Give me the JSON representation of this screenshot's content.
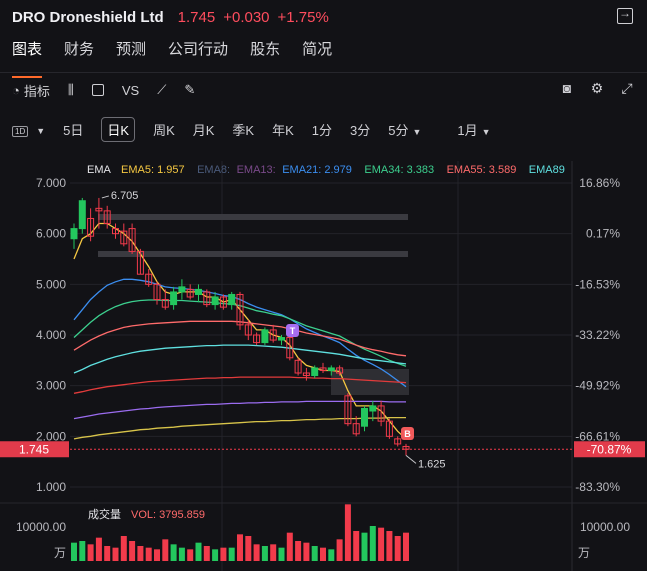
{
  "header": {
    "name": "DRO Droneshield Ltd",
    "price": "1.745",
    "change": "+0.030",
    "change_pct": "+1.75%"
  },
  "tabs": [
    "图表",
    "财务",
    "预测",
    "公司行动",
    "股东",
    "简况"
  ],
  "toolbar": {
    "indicator": "指标",
    "vs": "VS"
  },
  "periods": {
    "badge": "1D",
    "items": [
      "5日",
      "日K",
      "周K",
      "月K",
      "季K",
      "年K",
      "1分",
      "3分",
      "5分",
      "1月"
    ]
  },
  "legend": {
    "label": "EMA",
    "items": [
      {
        "text": "EMA5: 1.957",
        "color": "#f5c842"
      },
      {
        "text": "EMA8:",
        "color": "#4a5a7a"
      },
      {
        "text": "EMA13:",
        "color": "#7a4a8a"
      },
      {
        "text": "EMA21: 2.979",
        "color": "#3b8ef0"
      },
      {
        "text": "EMA34: 3.383",
        "color": "#3ccf8e"
      },
      {
        "text": "EMA55: 3.589",
        "color": "#ff6b6b"
      },
      {
        "text": "EMA89",
        "color": "#5fe0e0"
      }
    ]
  },
  "annotations": {
    "high": "6.705",
    "low": "1.625",
    "marker_t": "T",
    "marker_b": "B"
  },
  "price_tag": {
    "left": "1.745",
    "right": "-70.87%"
  },
  "volume": {
    "title": "成交量",
    "vol": "VOL: 3795.859",
    "left_axis": "10000.00",
    "left_unit": "万",
    "right_axis": "10000.00",
    "right_unit": "万"
  },
  "chart_data": {
    "type": "candlestick",
    "y_axis_left": [
      "7.000",
      "6.000",
      "5.000",
      "4.000",
      "3.000",
      "2.000",
      "1.000"
    ],
    "y_axis_right": [
      "16.86%",
      "0.17%",
      "-16.53%",
      "-33.22%",
      "-49.92%",
      "-66.61%",
      "-83.30%"
    ],
    "ylim": [
      1.0,
      7.0
    ],
    "candles": [
      {
        "o": 5.9,
        "h": 6.2,
        "l": 5.7,
        "c": 6.1
      },
      {
        "o": 6.1,
        "h": 6.705,
        "l": 6.0,
        "c": 6.65
      },
      {
        "o": 6.3,
        "h": 6.5,
        "l": 5.85,
        "c": 5.95
      },
      {
        "o": 6.5,
        "h": 6.705,
        "l": 6.1,
        "c": 6.45
      },
      {
        "o": 6.45,
        "h": 6.55,
        "l": 6.1,
        "c": 6.2
      },
      {
        "o": 6.1,
        "h": 6.2,
        "l": 5.9,
        "c": 6.0
      },
      {
        "o": 6.05,
        "h": 6.2,
        "l": 5.75,
        "c": 5.8
      },
      {
        "o": 6.1,
        "h": 6.2,
        "l": 5.6,
        "c": 5.65
      },
      {
        "o": 5.65,
        "h": 5.7,
        "l": 5.2,
        "c": 5.2
      },
      {
        "o": 5.2,
        "h": 5.3,
        "l": 4.95,
        "c": 5.0
      },
      {
        "o": 5.0,
        "h": 5.05,
        "l": 4.6,
        "c": 4.7
      },
      {
        "o": 4.7,
        "h": 4.9,
        "l": 4.5,
        "c": 4.55
      },
      {
        "o": 4.6,
        "h": 4.95,
        "l": 4.5,
        "c": 4.85
      },
      {
        "o": 4.85,
        "h": 5.1,
        "l": 4.7,
        "c": 4.95
      },
      {
        "o": 4.9,
        "h": 5.0,
        "l": 4.7,
        "c": 4.75
      },
      {
        "o": 4.8,
        "h": 5.0,
        "l": 4.65,
        "c": 4.9
      },
      {
        "o": 4.85,
        "h": 4.9,
        "l": 4.55,
        "c": 4.6
      },
      {
        "o": 4.6,
        "h": 4.85,
        "l": 4.5,
        "c": 4.75
      },
      {
        "o": 4.75,
        "h": 4.8,
        "l": 4.5,
        "c": 4.55
      },
      {
        "o": 4.6,
        "h": 4.85,
        "l": 4.5,
        "c": 4.8
      },
      {
        "o": 4.8,
        "h": 4.85,
        "l": 4.1,
        "c": 4.2
      },
      {
        "o": 4.2,
        "h": 4.3,
        "l": 3.9,
        "c": 4.0
      },
      {
        "o": 4.0,
        "h": 4.05,
        "l": 3.8,
        "c": 3.85
      },
      {
        "o": 3.85,
        "h": 4.15,
        "l": 3.8,
        "c": 4.1
      },
      {
        "o": 4.1,
        "h": 4.2,
        "l": 3.85,
        "c": 3.9
      },
      {
        "o": 3.9,
        "h": 4.0,
        "l": 3.8,
        "c": 3.95
      },
      {
        "o": 3.95,
        "h": 4.05,
        "l": 3.5,
        "c": 3.55
      },
      {
        "o": 3.5,
        "h": 3.55,
        "l": 3.2,
        "c": 3.25
      },
      {
        "o": 3.25,
        "h": 3.35,
        "l": 3.1,
        "c": 3.2
      },
      {
        "o": 3.2,
        "h": 3.4,
        "l": 3.15,
        "c": 3.35
      },
      {
        "o": 3.35,
        "h": 3.45,
        "l": 3.25,
        "c": 3.3
      },
      {
        "o": 3.3,
        "h": 3.4,
        "l": 3.2,
        "c": 3.35
      },
      {
        "o": 3.35,
        "h": 3.4,
        "l": 3.2,
        "c": 3.25
      },
      {
        "o": 2.8,
        "h": 2.85,
        "l": 2.2,
        "c": 2.25
      },
      {
        "o": 2.25,
        "h": 2.4,
        "l": 2.0,
        "c": 2.05
      },
      {
        "o": 2.2,
        "h": 2.6,
        "l": 2.1,
        "c": 2.55
      },
      {
        "o": 2.5,
        "h": 2.7,
        "l": 2.3,
        "c": 2.6
      },
      {
        "o": 2.6,
        "h": 2.7,
        "l": 2.2,
        "c": 2.3
      },
      {
        "o": 2.3,
        "h": 2.35,
        "l": 1.95,
        "c": 2.0
      },
      {
        "o": 1.95,
        "h": 2.0,
        "l": 1.8,
        "c": 1.85
      },
      {
        "o": 1.8,
        "h": 1.85,
        "l": 1.625,
        "c": 1.745
      }
    ],
    "ema": [
      {
        "name": "EMA5",
        "color": "#f5c842",
        "values": [
          5.5,
          5.9,
          6.0,
          6.2,
          6.2,
          6.1,
          6.0,
          5.85,
          5.6,
          5.35,
          5.05,
          4.85,
          4.8,
          4.85,
          4.85,
          4.85,
          4.75,
          4.75,
          4.65,
          4.7,
          4.5,
          4.3,
          4.1,
          4.1,
          4.0,
          3.95,
          3.8,
          3.55,
          3.4,
          3.35,
          3.3,
          3.3,
          3.28,
          2.9,
          2.6,
          2.6,
          2.6,
          2.5,
          2.3,
          2.1,
          1.95
        ]
      },
      {
        "name": "EMA21",
        "color": "#3b8ef0",
        "values": [
          4.3,
          4.5,
          4.7,
          4.85,
          4.98,
          5.05,
          5.1,
          5.1,
          5.08,
          5.05,
          5.0,
          4.95,
          4.93,
          4.92,
          4.9,
          4.88,
          4.85,
          4.82,
          4.78,
          4.76,
          4.7,
          4.62,
          4.55,
          4.5,
          4.45,
          4.4,
          4.32,
          4.22,
          4.12,
          4.05,
          3.98,
          3.92,
          3.85,
          3.72,
          3.6,
          3.5,
          3.42,
          3.33,
          3.22,
          3.1,
          2.979
        ]
      },
      {
        "name": "EMA34",
        "color": "#3ccf8e",
        "values": [
          3.95,
          4.1,
          4.25,
          4.38,
          4.48,
          4.56,
          4.62,
          4.66,
          4.68,
          4.69,
          4.69,
          4.68,
          4.68,
          4.68,
          4.67,
          4.66,
          4.65,
          4.64,
          4.62,
          4.61,
          4.58,
          4.53,
          4.48,
          4.45,
          4.41,
          4.38,
          4.32,
          4.25,
          4.18,
          4.13,
          4.08,
          4.03,
          3.98,
          3.89,
          3.8,
          3.72,
          3.65,
          3.58,
          3.5,
          3.44,
          3.383
        ]
      },
      {
        "name": "EMA55",
        "color": "#ff6b6b",
        "values": [
          3.7,
          3.8,
          3.9,
          3.98,
          4.05,
          4.1,
          4.15,
          4.18,
          4.2,
          4.22,
          4.23,
          4.24,
          4.25,
          4.26,
          4.27,
          4.27,
          4.27,
          4.27,
          4.27,
          4.27,
          4.26,
          4.24,
          4.22,
          4.2,
          4.18,
          4.16,
          4.12,
          4.08,
          4.04,
          4.01,
          3.98,
          3.95,
          3.92,
          3.86,
          3.8,
          3.75,
          3.71,
          3.68,
          3.64,
          3.61,
          3.589
        ]
      },
      {
        "name": "EMA89",
        "color": "#5fe0e0",
        "values": [
          3.25,
          3.32,
          3.4,
          3.46,
          3.52,
          3.57,
          3.61,
          3.65,
          3.68,
          3.7,
          3.72,
          3.74,
          3.75,
          3.76,
          3.77,
          3.78,
          3.79,
          3.79,
          3.8,
          3.8,
          3.8,
          3.8,
          3.79,
          3.78,
          3.77,
          3.76,
          3.74,
          3.72,
          3.7,
          3.68,
          3.66,
          3.64,
          3.62,
          3.59,
          3.56,
          3.53,
          3.51,
          3.49,
          3.47,
          3.45,
          3.43
        ]
      },
      {
        "name": "EMA144",
        "color": "#e23b3b",
        "values": [
          2.85,
          2.88,
          2.92,
          2.95,
          2.98,
          3.0,
          3.02,
          3.04,
          3.06,
          3.08,
          3.09,
          3.1,
          3.11,
          3.12,
          3.13,
          3.14,
          3.15,
          3.15,
          3.16,
          3.16,
          3.17,
          3.17,
          3.17,
          3.17,
          3.17,
          3.17,
          3.17,
          3.16,
          3.16,
          3.15,
          3.15,
          3.14,
          3.14,
          3.13,
          3.12,
          3.11,
          3.1,
          3.09,
          3.08,
          3.07,
          3.06
        ]
      },
      {
        "name": "EMA233",
        "color": "#9b6cf0",
        "values": [
          2.35,
          2.38,
          2.41,
          2.44,
          2.46,
          2.48,
          2.5,
          2.52,
          2.54,
          2.55,
          2.57,
          2.58,
          2.59,
          2.6,
          2.61,
          2.62,
          2.63,
          2.63,
          2.64,
          2.65,
          2.65,
          2.66,
          2.66,
          2.67,
          2.67,
          2.68,
          2.68,
          2.68,
          2.69,
          2.69,
          2.69,
          2.69,
          2.69,
          2.69,
          2.69,
          2.69,
          2.69,
          2.69,
          2.68,
          2.68,
          2.68
        ]
      },
      {
        "name": "EMA377",
        "color": "#d8c44a",
        "values": [
          1.95,
          1.98,
          2.0,
          2.03,
          2.05,
          2.07,
          2.09,
          2.11,
          2.13,
          2.14,
          2.16,
          2.17,
          2.18,
          2.2,
          2.21,
          2.22,
          2.23,
          2.24,
          2.25,
          2.26,
          2.27,
          2.28,
          2.29,
          2.29,
          2.3,
          2.31,
          2.31,
          2.32,
          2.33,
          2.33,
          2.34,
          2.34,
          2.35,
          2.35,
          2.35,
          2.36,
          2.36,
          2.36,
          2.37,
          2.37,
          2.37
        ]
      }
    ],
    "volume": [
      1100,
      1200,
      1000,
      1400,
      900,
      800,
      1500,
      1200,
      900,
      800,
      700,
      1300,
      1000,
      800,
      700,
      1100,
      900,
      700,
      800,
      800,
      1600,
      1500,
      1000,
      900,
      1000,
      800,
      1700,
      1200,
      1100,
      900,
      800,
      700,
      1300,
      3400,
      1800,
      1700,
      2100,
      2000,
      1800,
      1500,
      1700
    ]
  }
}
